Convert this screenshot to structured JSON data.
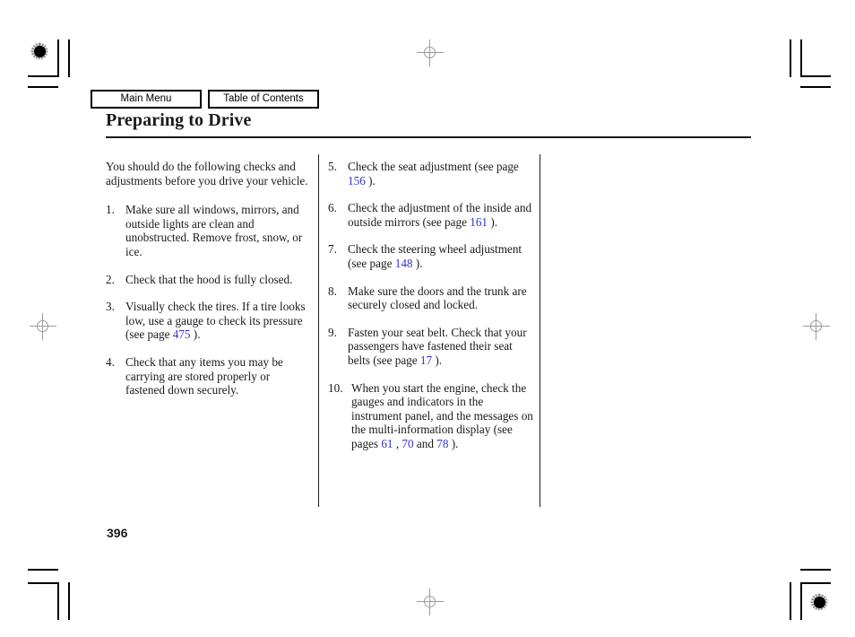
{
  "nav": {
    "main_menu": "Main Menu",
    "table_of_contents": "Table of Contents"
  },
  "header": {
    "title": "Preparing to Drive"
  },
  "content": {
    "intro": "You should do the following checks and adjustments before you drive your vehicle.",
    "left_items": [
      {
        "num": "1.",
        "text": "Make sure all windows, mirrors, and outside lights are clean and unobstructed. Remove frost, snow, or ice."
      },
      {
        "num": "2.",
        "text": "Check that the hood is fully closed."
      },
      {
        "num": "3.",
        "text_before": "Visually check the tires. If a tire looks low, use a gauge to check its pressure (see page ",
        "link": "475",
        "text_after": " )."
      },
      {
        "num": "4.",
        "text": "Check that any items you may be carrying are stored properly or fastened down securely."
      }
    ],
    "right_items": [
      {
        "num": "5.",
        "text_before": "Check the seat adjustment (see page ",
        "link": "156",
        "text_after": " )."
      },
      {
        "num": "6.",
        "text_before": "Check the adjustment of the inside and outside mirrors (see page ",
        "link": "161",
        "text_after": " )."
      },
      {
        "num": "7.",
        "text_before": "Check the steering wheel adjustment (see page ",
        "link": "148",
        "text_after": " )."
      },
      {
        "num": "8.",
        "text": "Make sure the doors and the trunk are securely closed and locked."
      },
      {
        "num": "9.",
        "text_before": "Fasten your seat belt. Check that your passengers have fastened their seat belts (see page ",
        "link": "17",
        "text_after": " )."
      },
      {
        "num": "10.",
        "text_before": "When you start the engine, check the gauges and indicators in the instrument panel, and the messages on the multi-information display (see pages ",
        "link": "61",
        "text_mid1": " , ",
        "link2": "70",
        "text_mid2": " and ",
        "link3": "78",
        "text_after": " )."
      }
    ]
  },
  "footer": {
    "page_number": "396"
  },
  "colors": {
    "link": "#3333cc",
    "text": "#1a1a1a",
    "rule": "#1a1a1a"
  }
}
